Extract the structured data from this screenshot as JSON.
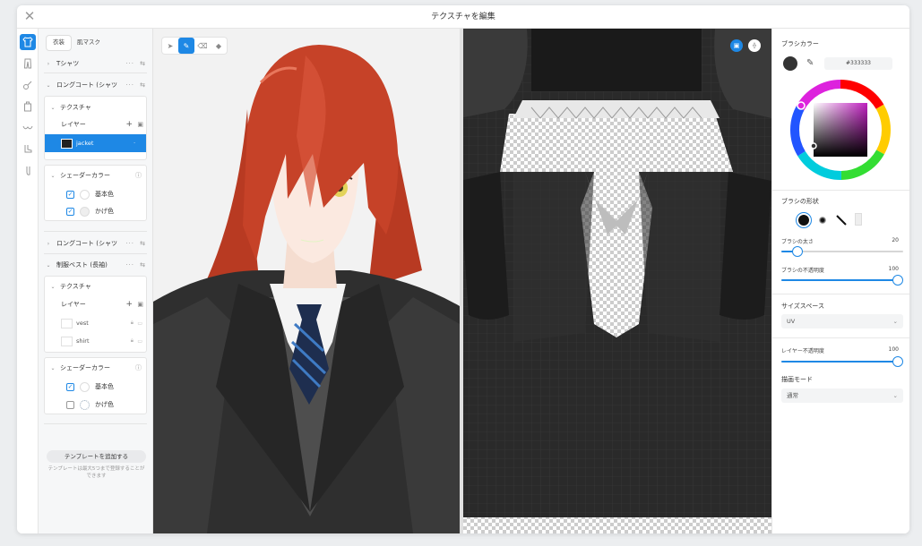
{
  "window": {
    "title": "テクスチャを編集"
  },
  "left_tabs": [
    "衣装",
    "肌マスク"
  ],
  "groups": [
    {
      "name": "Tシャツ"
    },
    {
      "name": "ロングコート (シャツ"
    },
    {
      "name": "ロングコート (シャツ"
    },
    {
      "name": "制服ベスト (長袖)"
    }
  ],
  "section_labels": {
    "texture": "テクスチャ",
    "layer": "レイヤー",
    "shader_color": "シェーダーカラー",
    "base_color": "基本色",
    "shade_color": "かげ色"
  },
  "layers_coat": [
    {
      "name": "jacket",
      "selected": true
    }
  ],
  "layers_vest": [
    {
      "name": "vest"
    },
    {
      "name": "shirt"
    }
  ],
  "coat_shader": {
    "base_checked": true,
    "shade_checked": true
  },
  "vest_shader": {
    "base_checked": true,
    "shade_checked": false
  },
  "template": {
    "add_label": "テンプレートを追加する",
    "note": "テンプレートは最大5つまで登録することができます"
  },
  "right": {
    "brush_color_label": "ブラシカラー",
    "brush_color_hex": "#333333",
    "brush_shape_label": "ブラシの形状",
    "brush_size_label": "ブラシの太さ",
    "brush_size_value": "20",
    "brush_size_fraction": 0.1,
    "brush_opacity_label": "ブラシの不透明度",
    "brush_opacity_value": "100",
    "brush_opacity_fraction": 1.0,
    "size_space_label": "サイズスペース",
    "size_space_value": "UV",
    "layer_opacity_label": "レイヤー不透明度",
    "layer_opacity_value": "100",
    "layer_opacity_fraction": 1.0,
    "blend_mode_label": "描画モード",
    "blend_mode_value": "通常"
  },
  "colors": {
    "accent": "#1e88e5",
    "brush": "#333333"
  }
}
